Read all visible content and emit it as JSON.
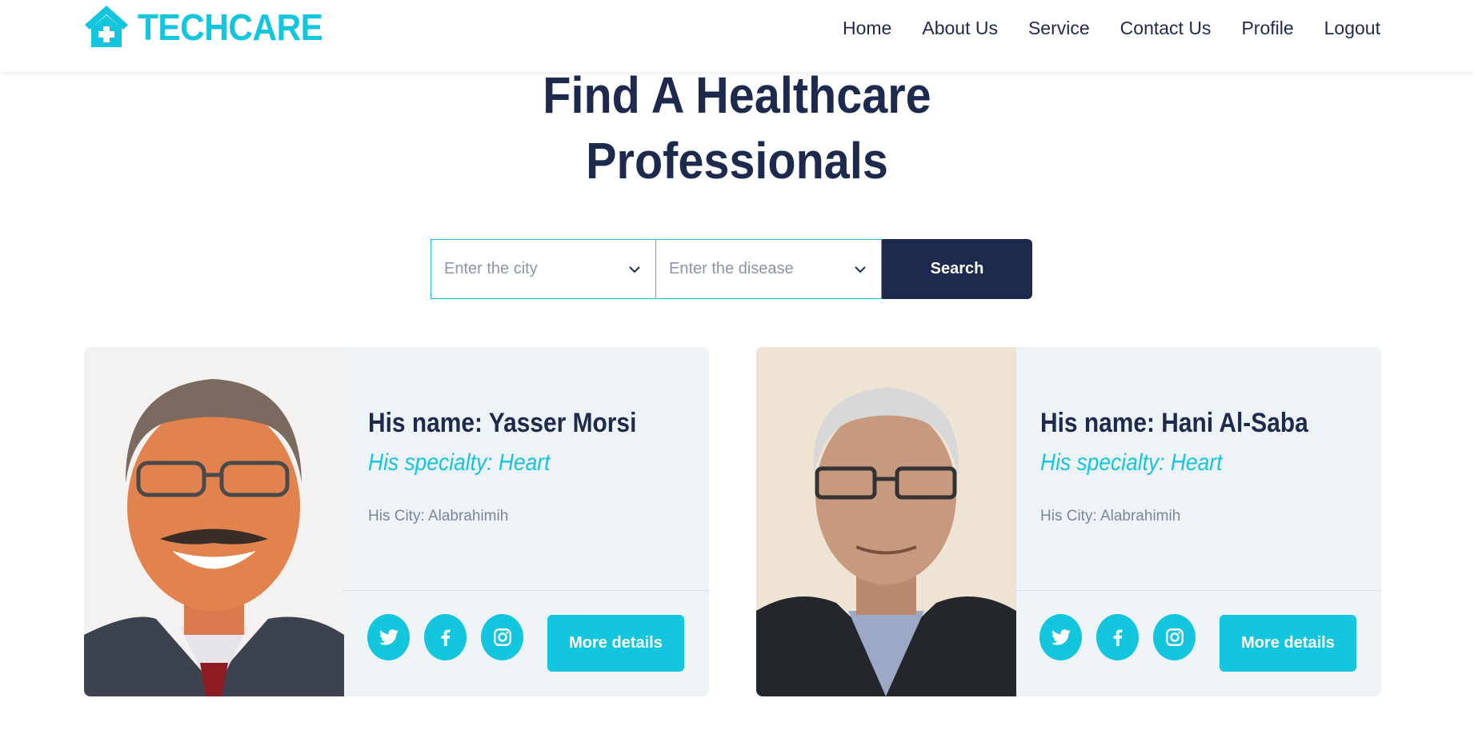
{
  "brand": {
    "name": "TECHCARE",
    "logo_icon": "house-medical-icon",
    "color": "#13c5dd"
  },
  "nav": {
    "items": [
      "Home",
      "About Us",
      "Service",
      "Contact Us",
      "Profile",
      "Logout"
    ]
  },
  "hero": {
    "title_line1": "Find A Healthcare",
    "title_line2": "Professionals"
  },
  "search": {
    "city_placeholder": "Enter the city",
    "disease_placeholder": "Enter the disease",
    "button_label": "Search"
  },
  "doctors": [
    {
      "name": "His name: Yasser Morsi",
      "specialty": "His specialty: Heart",
      "city": "His City: Alabrahimih",
      "details_label": "More details"
    },
    {
      "name": "His name: Hani Al-Saba",
      "specialty": "His specialty: Heart",
      "city": "His City: Alabrahimih",
      "details_label": "More details"
    }
  ],
  "social_icons": [
    "twitter-icon",
    "facebook-icon",
    "instagram-icon"
  ],
  "colors": {
    "primary": "#13c5dd",
    "dark": "#1d2a4d",
    "card_bg": "#eef3f7"
  }
}
